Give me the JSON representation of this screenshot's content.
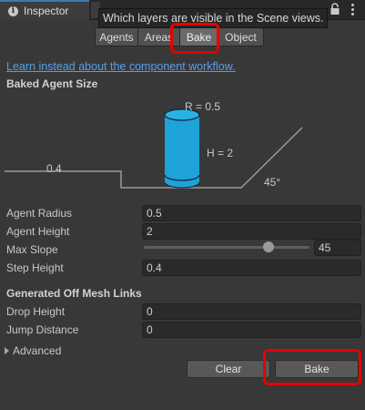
{
  "window": {
    "tab_title": "Inspector"
  },
  "tooltip": "Which layers are visible in the Scene views.",
  "section_tabs": [
    "Agents",
    "Areas",
    "Bake",
    "Object"
  ],
  "active_tab": "Bake",
  "link": "Learn instead about the component workflow.",
  "baked_agent_size": {
    "header": "Baked Agent Size",
    "diagram": {
      "radius_label": "R = 0.5",
      "height_label": "H = 2",
      "step_label": "0.4",
      "slope_label": "45°",
      "agent_color": "#1ea3d8"
    }
  },
  "fields": {
    "agent_radius": {
      "label": "Agent Radius",
      "value": "0.5"
    },
    "agent_height": {
      "label": "Agent Height",
      "value": "2"
    },
    "max_slope": {
      "label": "Max Slope",
      "value": "45",
      "slider_fraction": 0.75
    },
    "step_height": {
      "label": "Step Height",
      "value": "0.4"
    }
  },
  "off_mesh": {
    "header": "Generated Off Mesh Links",
    "drop_height": {
      "label": "Drop Height",
      "value": "0"
    },
    "jump_distance": {
      "label": "Jump Distance",
      "value": "0"
    }
  },
  "advanced": "Advanced",
  "buttons": {
    "clear": "Clear",
    "bake": "Bake"
  },
  "colors": {
    "highlight": "#e80000",
    "link": "#5a9ee8",
    "panel_bg": "#383838"
  }
}
